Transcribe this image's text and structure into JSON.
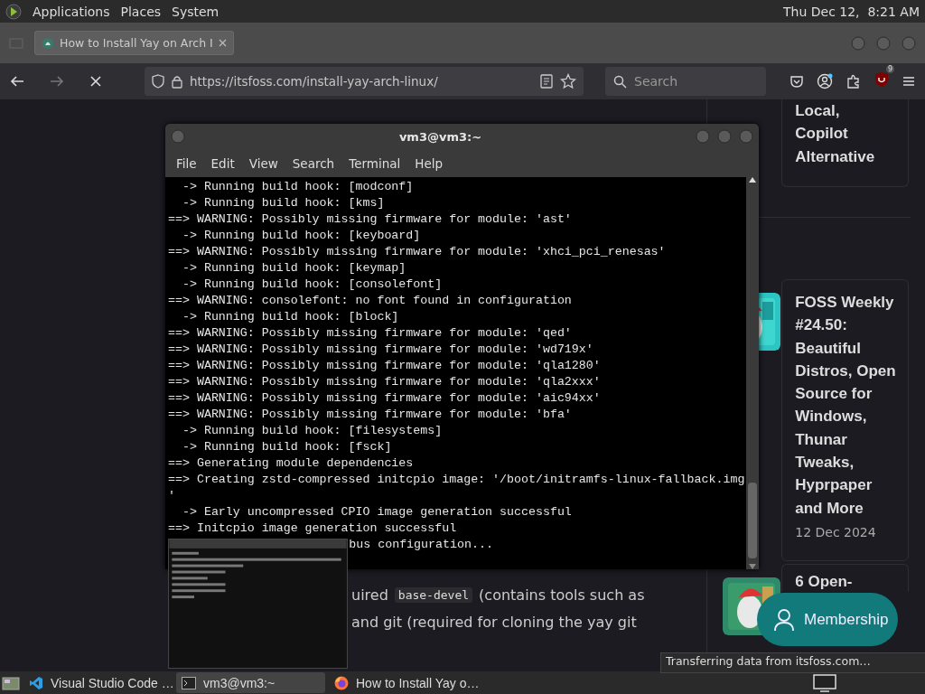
{
  "top_panel": {
    "menus": [
      "Applications",
      "Places",
      "System"
    ],
    "clock": "Thu Dec 12,  8:21 AM"
  },
  "browser": {
    "tabs": [
      {
        "title": "How to Install Yay on Arch I",
        "selected": true
      }
    ],
    "url": "https://itsfoss.com/install-yay-arch-linux/",
    "search": {
      "placeholder": "Search"
    },
    "extension_badge": "9"
  },
  "terminal": {
    "title": "vm3@vm3:~",
    "menu": [
      "File",
      "Edit",
      "View",
      "Search",
      "Terminal",
      "Help"
    ],
    "lines": [
      {
        "kind": "line",
        "text": "  -> Running build hook: [modconf]"
      },
      {
        "kind": "line",
        "text": "  -> Running build hook: [kms]"
      },
      {
        "kind": "line",
        "text": "==> WARNING: Possibly missing firmware for module: 'ast'"
      },
      {
        "kind": "line",
        "text": "  -> Running build hook: [keyboard]"
      },
      {
        "kind": "line",
        "text": "==> WARNING: Possibly missing firmware for module: 'xhci_pci_renesas'"
      },
      {
        "kind": "line",
        "text": "  -> Running build hook: [keymap]"
      },
      {
        "kind": "line",
        "text": "  -> Running build hook: [consolefont]"
      },
      {
        "kind": "line",
        "text": "==> WARNING: consolefont: no font found in configuration"
      },
      {
        "kind": "line",
        "text": "  -> Running build hook: [block]"
      },
      {
        "kind": "line",
        "text": "==> WARNING: Possibly missing firmware for module: 'qed'"
      },
      {
        "kind": "line",
        "text": "==> WARNING: Possibly missing firmware for module: 'wd719x'"
      },
      {
        "kind": "line",
        "text": "==> WARNING: Possibly missing firmware for module: 'qla1280'"
      },
      {
        "kind": "line",
        "text": "==> WARNING: Possibly missing firmware for module: 'qla2xxx'"
      },
      {
        "kind": "line",
        "text": "==> WARNING: Possibly missing firmware for module: 'aic94xx'"
      },
      {
        "kind": "line",
        "text": "==> WARNING: Possibly missing firmware for module: 'bfa'"
      },
      {
        "kind": "line",
        "text": "  -> Running build hook: [filesystems]"
      },
      {
        "kind": "line",
        "text": "  -> Running build hook: [fsck]"
      },
      {
        "kind": "line",
        "text": "==> Generating module dependencies"
      },
      {
        "kind": "line",
        "text": "==> Creating zstd-compressed initcpio image: '/boot/initramfs-linux-fallback.img"
      },
      {
        "kind": "line",
        "text": "'"
      },
      {
        "kind": "line",
        "text": "  -> Early uncompressed CPIO image generation successful"
      },
      {
        "kind": "line",
        "text": "==> Initcpio image generation successful"
      },
      {
        "kind": "covered",
        "text": "bus configuration..."
      }
    ]
  },
  "article": {
    "line_1": {
      "before": "uired",
      "code": "base-devel",
      "after": "(contains tools such as"
    },
    "line_2": "and git (required for cloning the yay git"
  },
  "sidebar": {
    "cards": [
      {
        "title_lines": [
          "Local,",
          "Copilot",
          "Alternative"
        ]
      },
      {
        "title_lines": [
          "FOSS Weekly",
          "#24.50:",
          "Beautiful",
          "Distros, Open",
          "Source for",
          "Windows,",
          "Thunar",
          "Tweaks,",
          "Hyprpaper",
          "and More"
        ],
        "date": "12 Dec 2024",
        "thumbnail": true
      },
      {
        "title_lines": [
          "6 Open-"
        ],
        "thumbnail": true
      }
    ]
  },
  "membership_button": "Membership",
  "status_tooltip": "Transferring data from itsfoss.com…",
  "taskbar": {
    "items": [
      {
        "kind": "vscode",
        "label": "Visual Studio Code …",
        "selected": false
      },
      {
        "kind": "terminal",
        "label": "vm3@vm3:~",
        "selected": true
      },
      {
        "kind": "firefox",
        "label": "How to Install Yay o…",
        "selected": false
      }
    ]
  }
}
